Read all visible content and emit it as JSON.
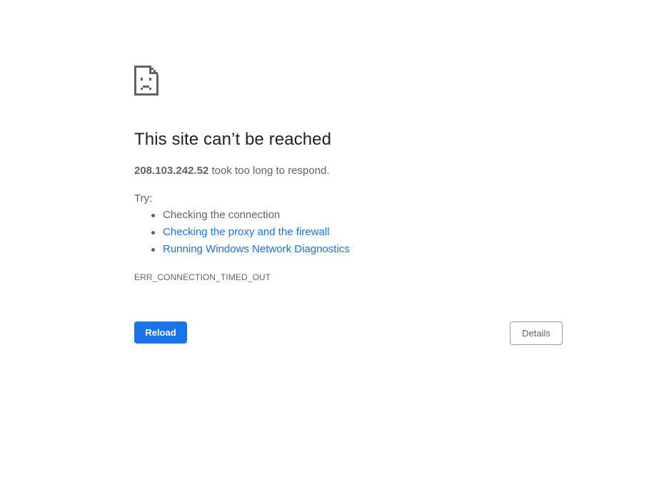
{
  "error_page": {
    "icon": "sad-document-icon",
    "title": "This site can’t be reached",
    "host": "208.103.242.52",
    "description_suffix": " took too long to respond.",
    "try_label": "Try:",
    "suggestions": [
      {
        "label": "Checking the connection",
        "is_link": false
      },
      {
        "label": "Checking the proxy and the firewall",
        "is_link": true
      },
      {
        "label": "Running Windows Network Diagnostics",
        "is_link": true
      }
    ],
    "error_code": "ERR_CONNECTION_TIMED_OUT",
    "reload_label": "Reload",
    "details_label": "Details"
  },
  "colors": {
    "accent": "#1a73e8",
    "title_text": "#202124",
    "body_text": "#5f6368"
  }
}
